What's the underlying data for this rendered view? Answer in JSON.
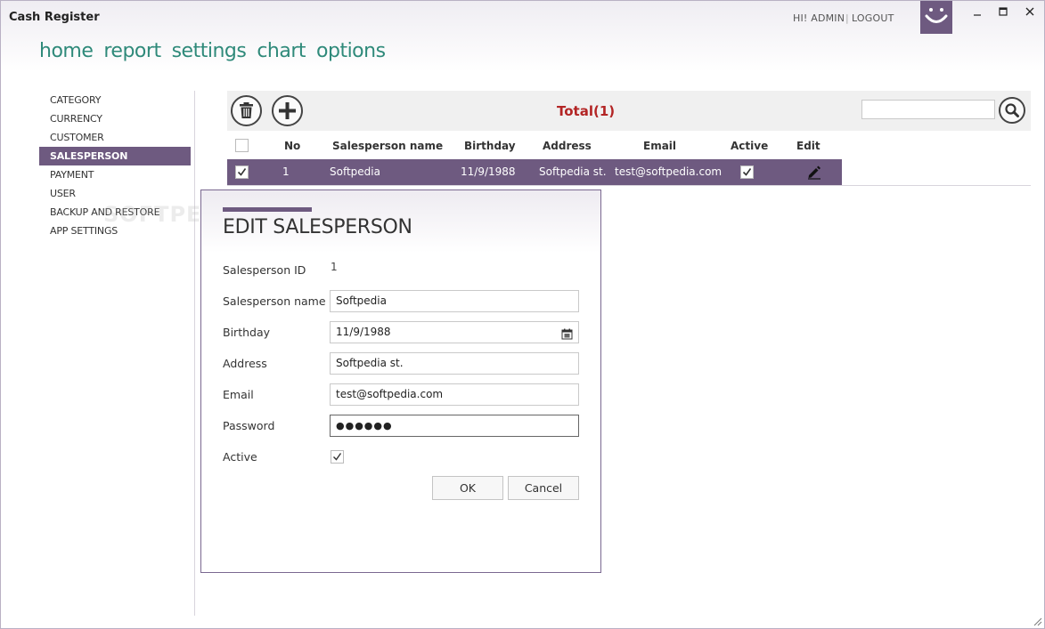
{
  "window": {
    "title": "Cash Register"
  },
  "header": {
    "greeting": "HI! ADMIN",
    "separator": "|",
    "logout_label": "LOGOUT",
    "logo_icon": "smiley-icon",
    "minimize": "🗕",
    "maximize": "🗖",
    "close": "✕"
  },
  "nav": {
    "items": [
      {
        "label": "home"
      },
      {
        "label": "report"
      },
      {
        "label": "settings"
      },
      {
        "label": "chart"
      },
      {
        "label": "options"
      }
    ]
  },
  "sidebar": {
    "items": [
      {
        "label": "CATEGORY",
        "active": false
      },
      {
        "label": "CURRENCY",
        "active": false
      },
      {
        "label": "CUSTOMER",
        "active": false
      },
      {
        "label": "SALESPERSON",
        "active": true
      },
      {
        "label": "PAYMENT",
        "active": false
      },
      {
        "label": "USER",
        "active": false
      },
      {
        "label": "BACKUP AND RESTORE",
        "active": false
      },
      {
        "label": "APP SETTINGS",
        "active": false
      }
    ],
    "active_color": "#6e5a80"
  },
  "toolbar": {
    "delete_icon": "trash-icon",
    "add_icon": "plus-icon",
    "total_label": "Total(1)",
    "search_value": "",
    "search_icon": "magnifier-icon",
    "total_color": "#b32525"
  },
  "table": {
    "columns": [
      "No",
      "Salesperson name",
      "Birthday",
      "Address",
      "Email",
      "Active",
      "Edit"
    ],
    "rows": [
      {
        "selected": true,
        "no": "1",
        "name": "Softpedia",
        "birthday": "11/9/1988",
        "address": "Softpedia st.",
        "email": "test@softpedia.com",
        "active": true,
        "edit_icon": "pencil-icon"
      }
    ]
  },
  "dialog": {
    "title": "EDIT SALESPERSON",
    "fields": {
      "id_label": "Salesperson ID",
      "id_value": "1",
      "name_label": "Salesperson name",
      "name_value": "Softpedia",
      "birthday_label": "Birthday",
      "birthday_value": "11/9/1988",
      "address_label": "Address",
      "address_value": "Softpedia st.",
      "email_label": "Email",
      "email_value": "test@softpedia.com",
      "password_label": "Password",
      "password_value": "●●●●●●",
      "active_label": "Active",
      "active_checked": true
    },
    "ok_label": "OK",
    "cancel_label": "Cancel"
  },
  "watermark": "SOFTPEDIA",
  "colors": {
    "accent": "#6e5a80",
    "nav": "#2f8a7a"
  }
}
